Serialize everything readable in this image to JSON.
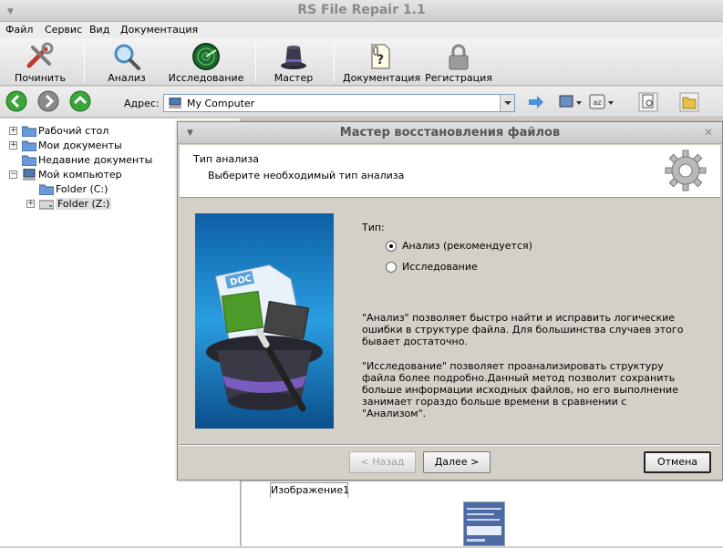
{
  "window": {
    "title": "RS File Repair 1.1"
  },
  "menu": [
    "Файл",
    "Сервис",
    "Вид",
    "Документация"
  ],
  "toolbar": {
    "repair": "Починить",
    "analysis": "Анализ",
    "research": "Исследование",
    "wizard": "Мастер",
    "docs": "Документация",
    "register": "Регистрация"
  },
  "address": {
    "label": "Адрес:",
    "value": "My Computer"
  },
  "tree": [
    {
      "label": "Рабочий стол",
      "expander": "+"
    },
    {
      "label": "Мои документы",
      "expander": "+"
    },
    {
      "label": "Недавние документы",
      "expander": ""
    },
    {
      "label": "Мой компьютер",
      "expander": "−"
    },
    {
      "label": "Folder (C:)",
      "expander": ""
    },
    {
      "label": "Folder (Z:)",
      "expander": "+"
    }
  ],
  "viewer": {
    "tab": "Изображение1"
  },
  "dialog": {
    "title": "Мастер восстановления файлов",
    "header_title": "Тип анализа",
    "header_subtitle": "Выберите необходимый тип анализа",
    "type_label": "Тип:",
    "options": [
      {
        "label": "Анализ (рекомендуется)",
        "checked": true
      },
      {
        "label": "Исследование",
        "checked": false
      }
    ],
    "desc1": "\"Анализ\" позволяет быстро найти и исправить логические ошибки в структуре файла. Для большинства случаев этого бывает достаточно.",
    "desc2": "\"Исследование\" позволяет проанализировать структуру файла более подробно.Данный метод позволит сохранить больше информации исходных файлов, но его выполнение занимает гораздо больше времени в сравнении с \"Анализом\".",
    "back": "< Назад",
    "next": "Далее >",
    "cancel": "Отмена",
    "image_badge": "DOC"
  }
}
